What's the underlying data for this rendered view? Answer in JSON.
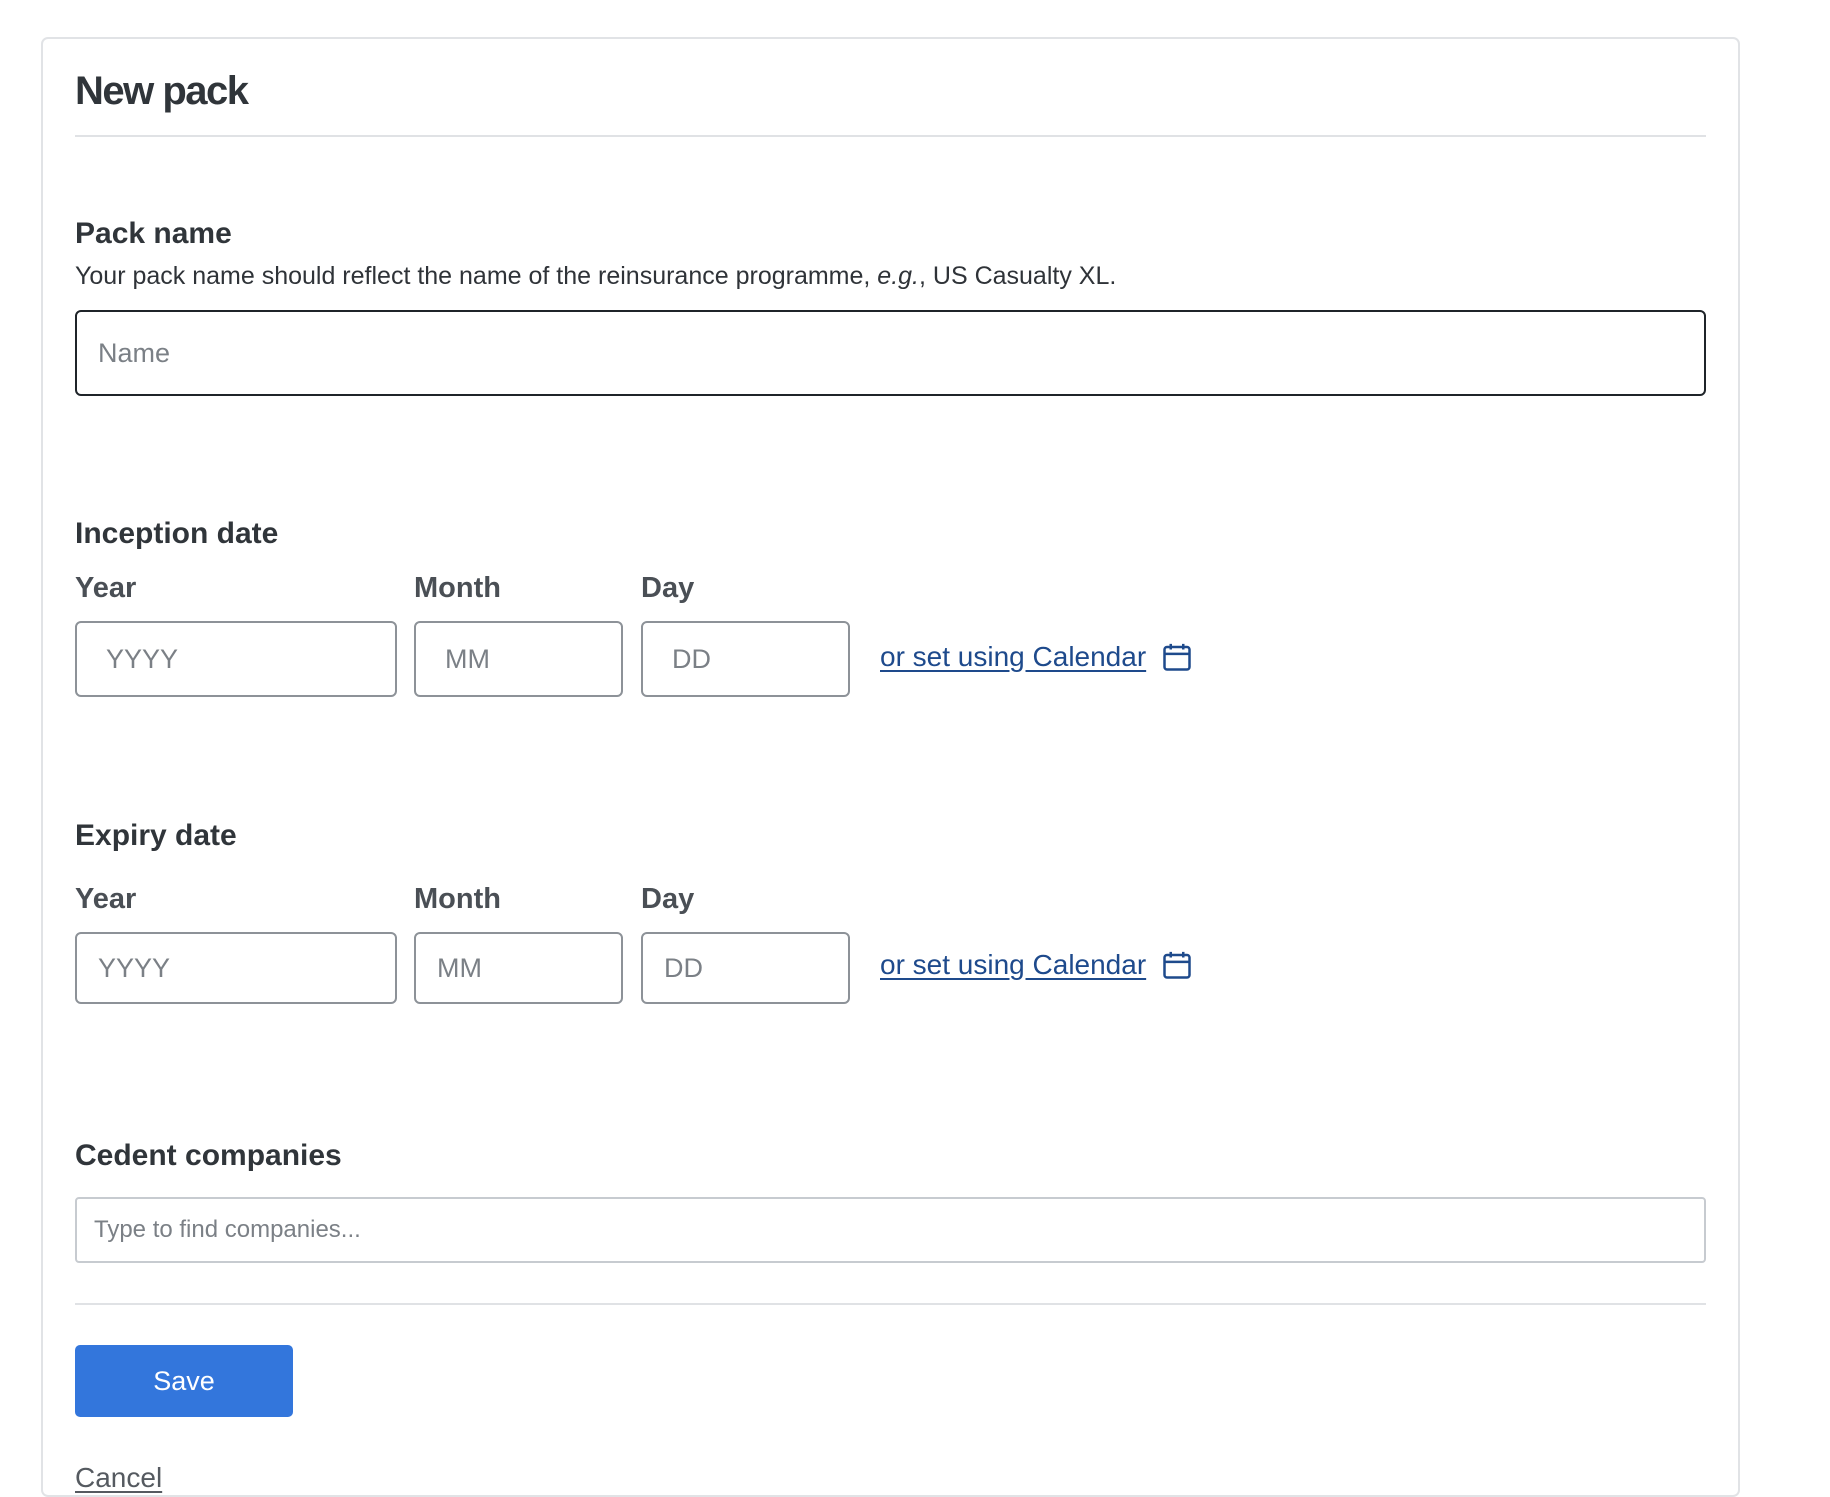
{
  "form": {
    "title": "New pack"
  },
  "pack_name": {
    "label": "Pack name",
    "hint_prefix": "Your pack name should reflect the name of the reinsurance programme, ",
    "hint_example_marker": "e.g.",
    "hint_suffix": ", US Casualty XL.",
    "placeholder": "Name",
    "value": ""
  },
  "inception_date": {
    "label": "Inception date",
    "year_label": "Year",
    "month_label": "Month",
    "day_label": "Day",
    "year_placeholder": "YYYY",
    "month_placeholder": "MM",
    "day_placeholder": "DD",
    "calendar_link": "or set using Calendar",
    "calendar_icon": "calendar-icon"
  },
  "expiry_date": {
    "label": "Expiry date",
    "year_label": "Year",
    "month_label": "Month",
    "day_label": "Day",
    "year_placeholder": "YYYY",
    "month_placeholder": "MM",
    "day_placeholder": "DD",
    "calendar_link": "or set using Calendar",
    "calendar_icon": "calendar-icon"
  },
  "cedent_companies": {
    "label": "Cedent companies",
    "placeholder": "Type to find companies...",
    "value": ""
  },
  "actions": {
    "save_label": "Save",
    "cancel_label": "Cancel"
  },
  "colors": {
    "primary": "#3376dc",
    "link": "#1e4a8c"
  }
}
